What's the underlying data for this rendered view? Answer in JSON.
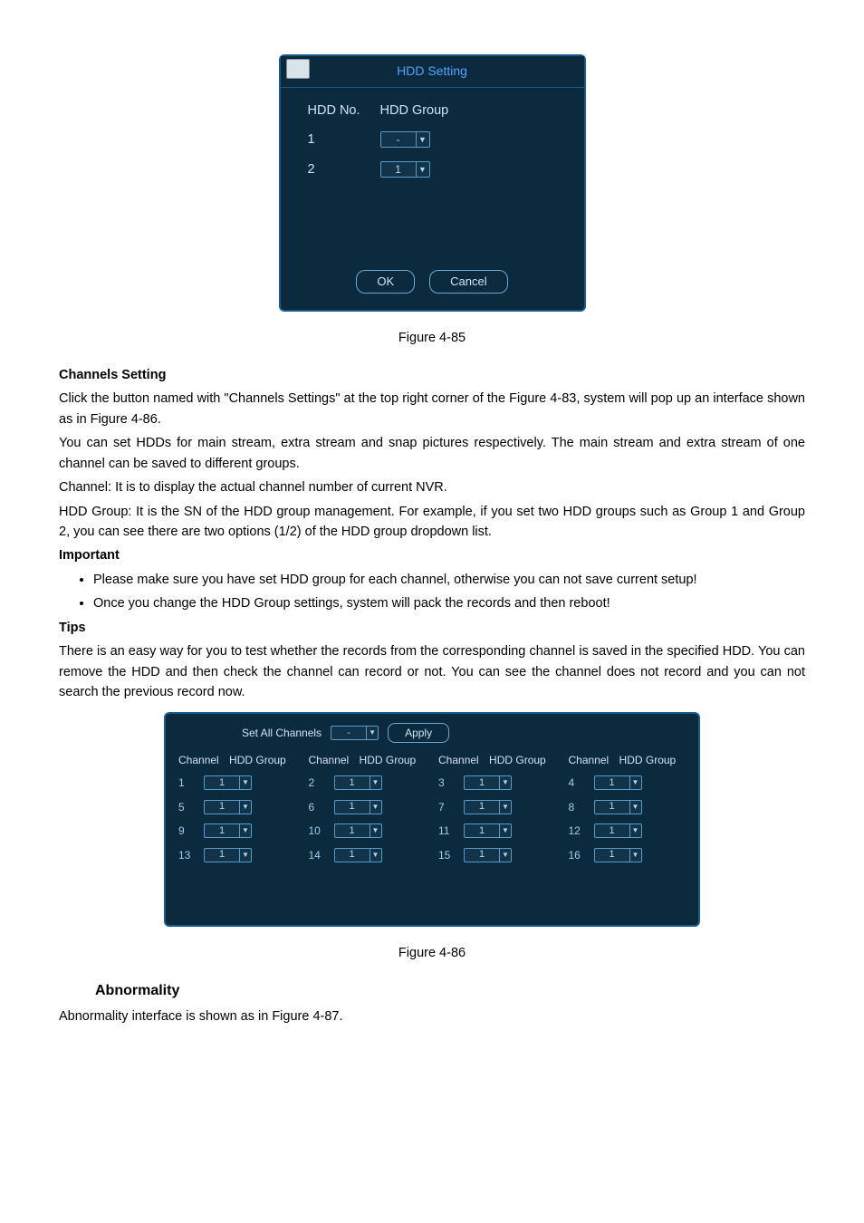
{
  "hdd_dialog": {
    "title": "HDD Setting",
    "col1": "HDD No.",
    "col2": "HDD Group",
    "rows": [
      {
        "no": "1",
        "group": "-"
      },
      {
        "no": "2",
        "group": "1"
      }
    ],
    "ok": "OK",
    "cancel": "Cancel"
  },
  "fig85": "Figure 4-85",
  "h_channels": "Channels Setting",
  "p1": "Click the button named with \"Channels Settings\" at the top right corner of the Figure 4-83, system will pop up an interface shown as in Figure 4-86.",
  "p2": "You can set HDDs for main stream, extra stream and snap pictures respectively. The main stream and extra stream of one channel can be saved to different groups.",
  "p3": "Channel: It is to display the actual channel number of current NVR.",
  "p4": "HDD Group: It is the SN of the HDD group management. For example, if you set two HDD groups such as Group 1 and Group 2, you can see there are two options (1/2) of the HDD group dropdown list.",
  "h_important": "Important",
  "b1": "Please make sure you have set HDD group for each channel, otherwise you can not save current setup!",
  "b2": "Once you change the HDD Group settings, system will pack the records and then reboot!",
  "h_tips": "Tips",
  "p5": "There is an easy way for you to test whether the records from the corresponding channel is saved in the specified HDD. You can remove the HDD and then check the channel can record or not. You can see the channel does not record and you can not search the previous record now.",
  "channels_dialog": {
    "set_all": "Set All Channels",
    "set_all_value": "-",
    "apply": "Apply",
    "head_channel": "Channel",
    "head_group": "HDD Group",
    "cells": [
      [
        "1",
        "1"
      ],
      [
        "2",
        "1"
      ],
      [
        "3",
        "1"
      ],
      [
        "4",
        "1"
      ],
      [
        "5",
        "1"
      ],
      [
        "6",
        "1"
      ],
      [
        "7",
        "1"
      ],
      [
        "8",
        "1"
      ],
      [
        "9",
        "1"
      ],
      [
        "10",
        "1"
      ],
      [
        "11",
        "1"
      ],
      [
        "12",
        "1"
      ],
      [
        "13",
        "1"
      ],
      [
        "14",
        "1"
      ],
      [
        "15",
        "1"
      ],
      [
        "16",
        "1"
      ]
    ]
  },
  "fig86": "Figure 4-86",
  "h_abnormality": "Abnormality",
  "p6": "Abnormality interface is shown as in Figure 4-87."
}
